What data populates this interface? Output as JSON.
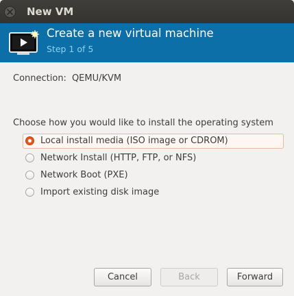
{
  "window": {
    "title": "New VM"
  },
  "header": {
    "title": "Create a new virtual machine",
    "step": "Step 1 of 5",
    "icon": "virtual-machine-icon"
  },
  "connection": {
    "label": "Connection:",
    "value": "QEMU/KVM"
  },
  "install": {
    "prompt": "Choose how you would like to install the operating system",
    "options": [
      {
        "label": "Local install media (ISO image or CDROM)",
        "selected": true
      },
      {
        "label": "Network Install (HTTP, FTP, or NFS)",
        "selected": false
      },
      {
        "label": "Network Boot (PXE)",
        "selected": false
      },
      {
        "label": "Import existing disk image",
        "selected": false
      }
    ]
  },
  "buttons": {
    "cancel": "Cancel",
    "back": "Back",
    "forward": "Forward",
    "back_enabled": false
  },
  "colors": {
    "banner": "#0d6fa8",
    "accent": "#e1571d",
    "titlebar": "#3b3a36"
  }
}
